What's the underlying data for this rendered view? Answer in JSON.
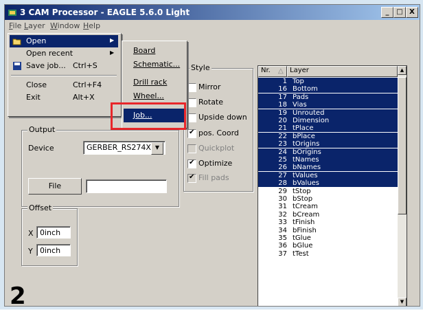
{
  "window": {
    "title": "3 CAM Processor - EAGLE 5.6.0 Light",
    "min": "_",
    "max": "□",
    "close": "X"
  },
  "menubar": [
    "File",
    "Layer",
    "Window",
    "Help"
  ],
  "file_menu": [
    {
      "label": "Open",
      "shortcut": "",
      "submenu": true
    },
    {
      "label": "Open recent",
      "shortcut": "",
      "submenu": true
    },
    {
      "label": "Save job...",
      "shortcut": "Ctrl+S",
      "submenu": false
    },
    {
      "label": "Close",
      "shortcut": "Ctrl+F4",
      "submenu": false
    },
    {
      "label": "Exit",
      "shortcut": "Alt+X",
      "submenu": false
    }
  ],
  "open_submenu": [
    "Board",
    "Schematic...",
    "Drill rack",
    "Wheel...",
    "Job..."
  ],
  "style": {
    "title": "Style",
    "options": [
      {
        "label": "Mirror",
        "checked": false,
        "disabled": false
      },
      {
        "label": "Rotate",
        "checked": false,
        "disabled": false
      },
      {
        "label": "Upside down",
        "checked": false,
        "disabled": false
      },
      {
        "label": "pos. Coord",
        "checked": true,
        "disabled": false
      },
      {
        "label": "Quickplot",
        "checked": false,
        "disabled": true
      },
      {
        "label": "Optimize",
        "checked": true,
        "disabled": false
      },
      {
        "label": "Fill pads",
        "checked": true,
        "disabled": true
      }
    ]
  },
  "output": {
    "title": "Output",
    "device_label": "Device",
    "device_value": "GERBER_RS274X",
    "file_button": "File",
    "file_value": ""
  },
  "offset": {
    "title": "Offset",
    "x_label": "X",
    "x_value": "0inch",
    "y_label": "Y",
    "y_value": "0inch"
  },
  "layers": {
    "header_nr": "Nr.",
    "header_layer": "Layer",
    "rows": [
      {
        "nr": "1",
        "name": "Top",
        "selected": true
      },
      {
        "nr": "16",
        "name": "Bottom",
        "selected": true
      },
      {
        "nr": "17",
        "name": "Pads",
        "selected": true
      },
      {
        "nr": "18",
        "name": "Vias",
        "selected": true
      },
      {
        "nr": "19",
        "name": "Unrouted",
        "selected": true
      },
      {
        "nr": "20",
        "name": "Dimension",
        "selected": true
      },
      {
        "nr": "21",
        "name": "tPlace",
        "selected": true
      },
      {
        "nr": "22",
        "name": "bPlace",
        "selected": true
      },
      {
        "nr": "23",
        "name": "tOrigins",
        "selected": true
      },
      {
        "nr": "24",
        "name": "bOrigins",
        "selected": true
      },
      {
        "nr": "25",
        "name": "tNames",
        "selected": true
      },
      {
        "nr": "26",
        "name": "bNames",
        "selected": true
      },
      {
        "nr": "27",
        "name": "tValues",
        "selected": true
      },
      {
        "nr": "28",
        "name": "bValues",
        "selected": true
      },
      {
        "nr": "29",
        "name": "tStop",
        "selected": false
      },
      {
        "nr": "30",
        "name": "bStop",
        "selected": false
      },
      {
        "nr": "31",
        "name": "tCream",
        "selected": false
      },
      {
        "nr": "32",
        "name": "bCream",
        "selected": false
      },
      {
        "nr": "33",
        "name": "tFinish",
        "selected": false
      },
      {
        "nr": "34",
        "name": "bFinish",
        "selected": false
      },
      {
        "nr": "35",
        "name": "tGlue",
        "selected": false
      },
      {
        "nr": "36",
        "name": "bGlue",
        "selected": false
      },
      {
        "nr": "37",
        "name": "tTest",
        "selected": false
      }
    ]
  },
  "step_number": "2",
  "colors": {
    "titlebar": "#0a246a",
    "highlight": "#e8262a",
    "selection": "#0a246a"
  }
}
